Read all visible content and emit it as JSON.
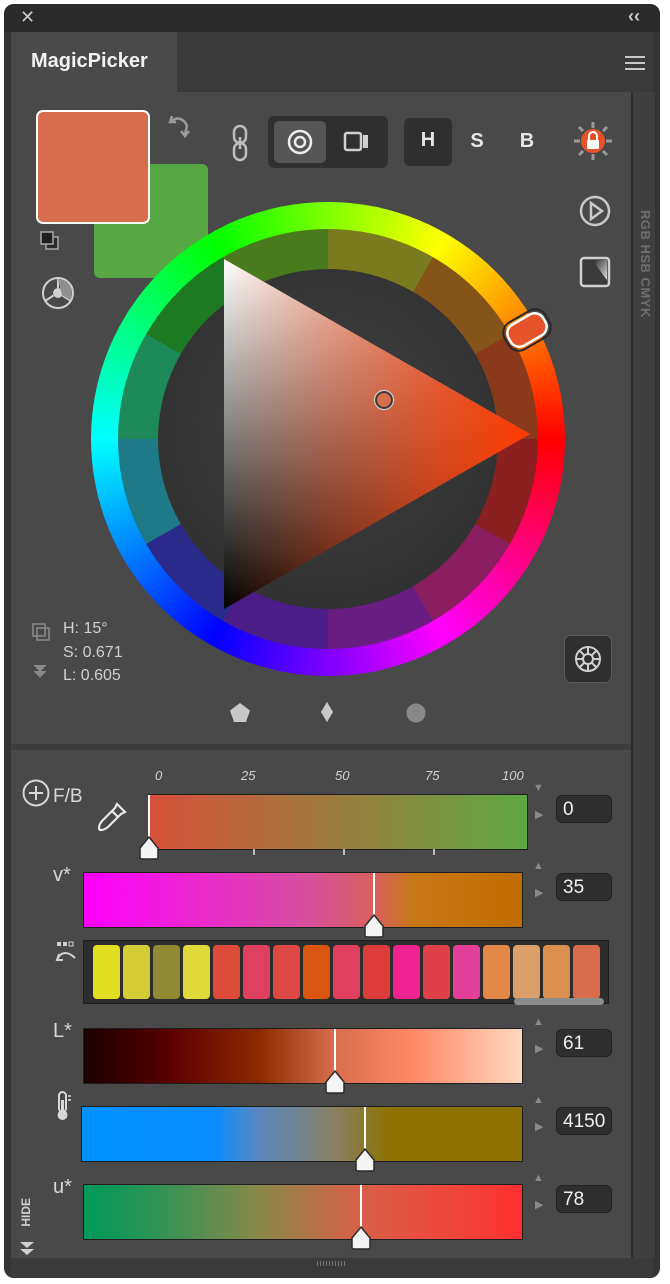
{
  "window": {
    "close_glyph": "✕",
    "collapse_glyph": "‹‹"
  },
  "tab": {
    "label": "MagicPicker"
  },
  "side_label": "RGB HSB CMYK",
  "hsb": {
    "h": "H",
    "s": "S",
    "b": "B"
  },
  "colors": {
    "foreground": "#d86d4e",
    "background": "#57a844",
    "accent": "#e6532b"
  },
  "readouts": {
    "h": "H: 15°",
    "s": "S: 0.671",
    "l": "L: 0.605"
  },
  "fb": {
    "label": "F/B",
    "ticks": [
      "0",
      "25",
      "50",
      "75",
      "100"
    ],
    "value": "0",
    "position_percent": 0
  },
  "sliders": [
    {
      "label": "v*",
      "value": "35",
      "position_percent": 66
    },
    {
      "label": "L*",
      "value": "61",
      "position_percent": 57
    },
    {
      "label": "",
      "value": "4150",
      "position_percent": 64
    },
    {
      "label": "u*",
      "value": "78",
      "position_percent": 63
    }
  ],
  "swatches": [
    "#e2de21",
    "#d4cc36",
    "#8f8a33",
    "#e0d93a",
    "#dc4a3a",
    "#e04060",
    "#dd4744",
    "#d95510",
    "#e04060",
    "#dd3d3a",
    "#ef2490",
    "#de4248",
    "#e2409a",
    "#e48848",
    "#dba06a",
    "#dc9050",
    "#d86d4e"
  ],
  "hide_label": "HIDE",
  "icons": [
    "close-icon",
    "collapse-icon",
    "menu-icon",
    "swap-icon",
    "link-icon",
    "wheel-mode-icon",
    "square-mode-icon",
    "lock-icon",
    "play-icon",
    "square-gradient-icon",
    "harmony-icon",
    "settings-wheel-icon",
    "pentagon-icon",
    "diamond-icon",
    "circle-icon",
    "add-icon",
    "eyedropper-icon",
    "palette-icon",
    "thermometer-icon"
  ]
}
